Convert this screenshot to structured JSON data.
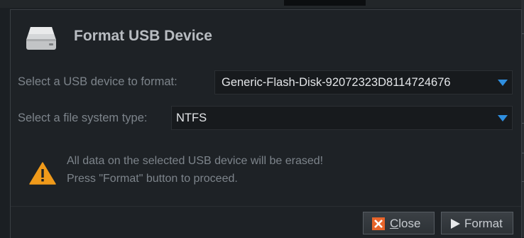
{
  "dialog": {
    "title": "Format USB Device",
    "device_label": "Select a USB device to format:",
    "device_value": "Generic-Flash-Disk-92072323D8114724676",
    "fs_label": "Select a file system type:",
    "fs_value": "NTFS",
    "warning_line1": "All data on the selected USB device will be erased!",
    "warning_line2": "Press \"Format\" button to proceed.",
    "close_first": "C",
    "close_rest": "lose",
    "format_label": "Format"
  },
  "colors": {
    "accent": "#2f8fe0",
    "warning": "#f09a1a",
    "close_icon": "#e8642a"
  },
  "icons": [
    "drive-icon",
    "dropdown-arrow-icon",
    "warning-icon",
    "close-x-icon",
    "play-icon"
  ]
}
